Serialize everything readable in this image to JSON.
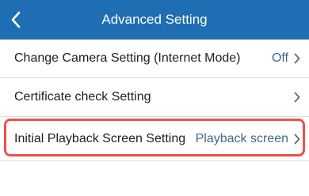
{
  "header": {
    "title": "Advanced Setting",
    "back_icon": "chevron-left-icon",
    "background_color": "#1f6db3"
  },
  "settings": {
    "items": [
      {
        "label": "Change Camera Setting (Internet Mode)",
        "value": "Off",
        "icon": "chevron-right-icon"
      },
      {
        "label": "Certificate check Setting",
        "value": "",
        "icon": "chevron-right-icon"
      },
      {
        "label": "Initial Playback Screen Setting",
        "value": "Playback screen",
        "icon": "chevron-right-icon"
      }
    ]
  },
  "highlight": {
    "color": "#e8524f"
  },
  "colors": {
    "value_text": "#3d6c87",
    "label_text": "#202020",
    "divider": "#d9dde2"
  }
}
